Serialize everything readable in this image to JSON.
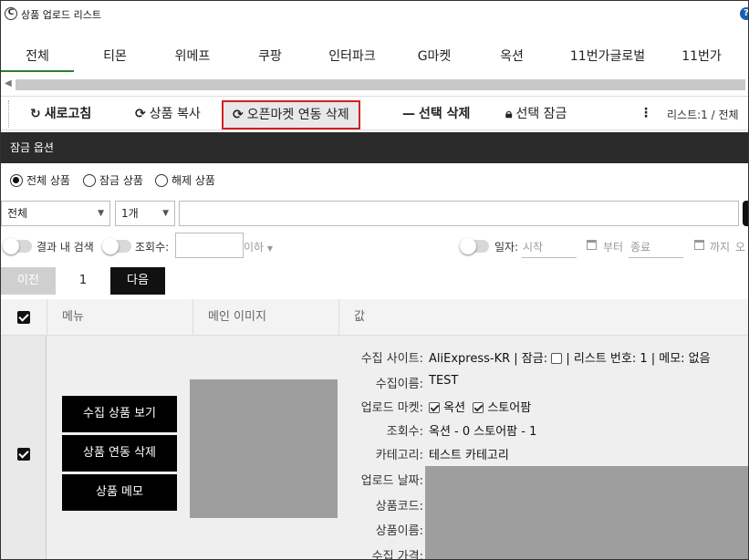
{
  "window": {
    "title": "상품 업로드 리스트",
    "help": "?"
  },
  "tabs": [
    {
      "label": "전체",
      "active": true
    },
    {
      "label": "티몬"
    },
    {
      "label": "위메프"
    },
    {
      "label": "쿠팡"
    },
    {
      "label": "인터파크"
    },
    {
      "label": "G마켓"
    },
    {
      "label": "옥션"
    },
    {
      "label": "11번가글로벌"
    },
    {
      "label": "11번가"
    }
  ],
  "toolbar": {
    "refresh": "새로고침",
    "copy": "상품 복사",
    "openmarket_delete": "오픈마켓 연동 삭제",
    "selected_delete": "선택 삭제",
    "selected_lock": "선택 잠금",
    "list_info": "리스트:1  /  전체"
  },
  "lock_options": {
    "title": "잠금 옵션"
  },
  "radios": [
    {
      "label": "전체 상품",
      "checked": true
    },
    {
      "label": "잠금 상품",
      "checked": false
    },
    {
      "label": "해제 상품",
      "checked": false
    }
  ],
  "filters": {
    "category_select": "전체",
    "count_select": "1개",
    "search_value": ""
  },
  "toggles": {
    "search_in_results": "결과 내 검색",
    "views": "조회수:",
    "views_condition": "이하",
    "date": "일자:",
    "start_placeholder": "시작",
    "from": "부터",
    "end_placeholder": "종료",
    "until": "까지",
    "cut_text": "오"
  },
  "pager": {
    "prev": "이전",
    "page": "1",
    "next": "다음"
  },
  "table": {
    "headers": {
      "menu": "메뉴",
      "main_image": "메인 이미지",
      "value": "값"
    },
    "row": {
      "actions": [
        "수집 상품 보기",
        "상품 연동 삭제",
        "상품 메모"
      ],
      "fields": {
        "site_label": "수집 사이트:",
        "site_value": "AliExpress-KR",
        "lock_label": "| 잠금:",
        "list_no": "| 리스트 번호: 1 | 메모: 없음",
        "name_label": "수집이름:",
        "name_value": "TEST",
        "market_label": "업로드 마켓:",
        "market_1": "옥션",
        "market_2": "스토어팜",
        "views_label": "조회수:",
        "views_value": "옥션 - 0  스토어팜 - 1",
        "category_label": "카테고리:",
        "category_value": "테스트 카테고리",
        "upload_date_label": "업로드 날짜:",
        "code_label": "상품코드:",
        "product_name_label": "상품이름:",
        "price_label": "수집 가격:"
      }
    }
  }
}
